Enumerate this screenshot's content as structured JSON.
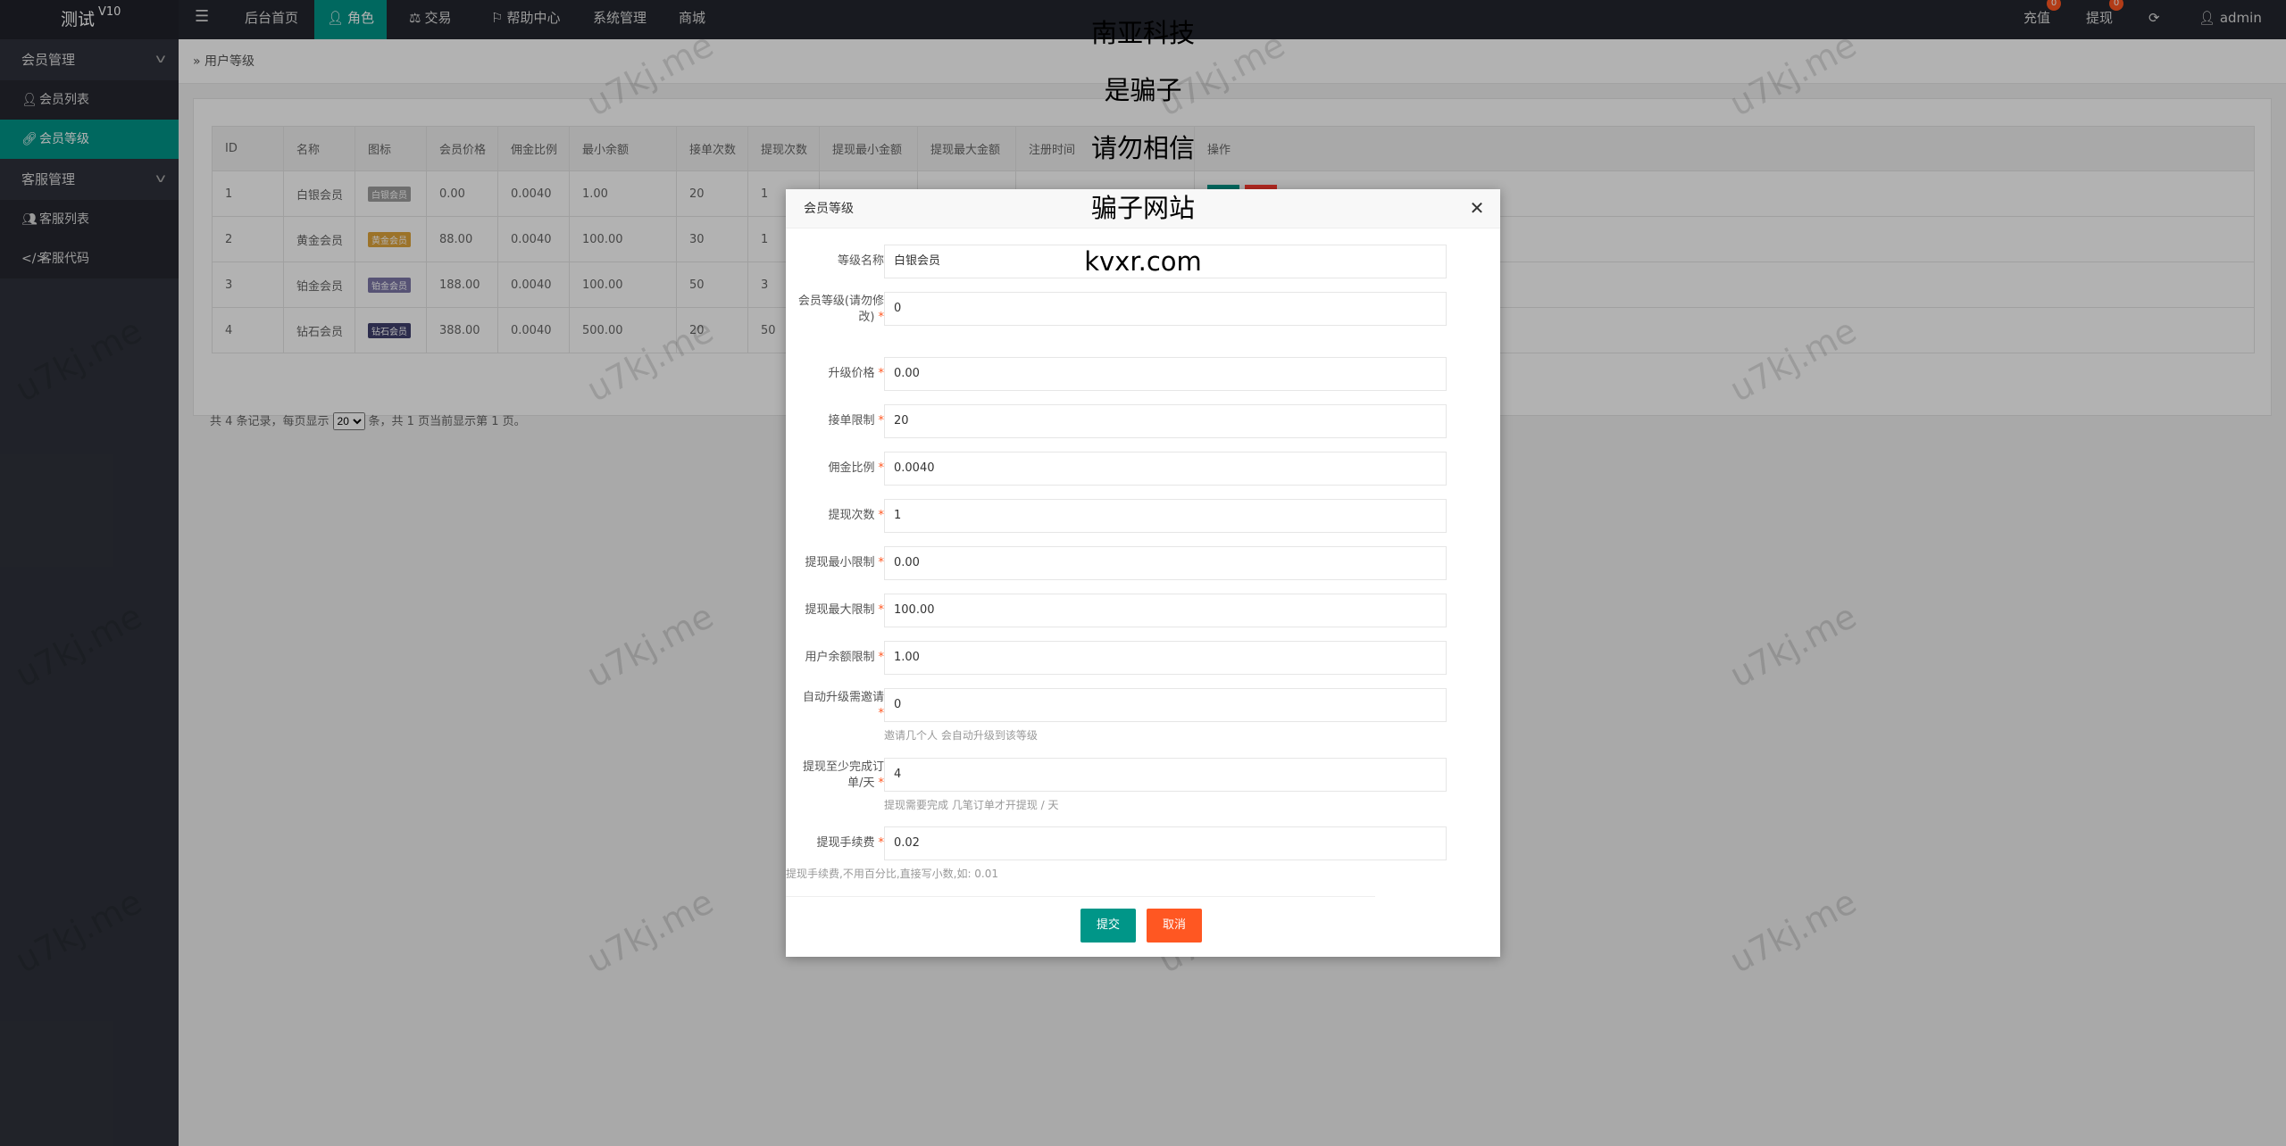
{
  "app": {
    "title": "测试",
    "version": "V10"
  },
  "nav": {
    "items": [
      {
        "label": "后台首页",
        "icon": "",
        "active": false
      },
      {
        "label": "角色",
        "icon": "user-icon",
        "active": true
      },
      {
        "label": "交易",
        "icon": "scale-icon",
        "active": false
      },
      {
        "label": "帮助中心",
        "icon": "flag-icon",
        "active": false
      },
      {
        "label": "系统管理",
        "icon": "",
        "active": false
      },
      {
        "label": "商城",
        "icon": "",
        "active": false
      }
    ],
    "right": {
      "recharge_label": "充值",
      "recharge_badge": "0",
      "withdraw_label": "提现",
      "withdraw_badge": "0",
      "refresh_icon": "refresh-icon",
      "user_label": "admin"
    }
  },
  "sidebar": {
    "groups": [
      {
        "label": "会员管理",
        "items": [
          {
            "label": "会员列表",
            "icon": "user-icon",
            "active": false
          },
          {
            "label": "会员等级",
            "icon": "link-icon",
            "active": true
          }
        ]
      },
      {
        "label": "客服管理",
        "items": [
          {
            "label": "客服列表",
            "icon": "users-icon",
            "active": false
          },
          {
            "label": "客服代码",
            "icon": "code-icon",
            "active": false
          }
        ]
      }
    ]
  },
  "breadcrumb": {
    "label": "用户等级"
  },
  "table": {
    "headers": [
      "ID",
      "名称",
      "图标",
      "会员价格",
      "佣金比例",
      "最小余额",
      "接单次数",
      "提现次数",
      "提现最小金额",
      "提现最大金额",
      "注册时间",
      "操作"
    ],
    "rows": [
      {
        "id": "1",
        "name": "白银会员",
        "icon_label": "白银会员",
        "price": "0.00",
        "commission": "0.0040",
        "min_balance": "1.00",
        "orders": "20",
        "withdraws": "1"
      },
      {
        "id": "2",
        "name": "黄金会员",
        "icon_label": "黄金会员",
        "price": "88.00",
        "commission": "0.0040",
        "min_balance": "100.00",
        "orders": "30",
        "withdraws": "1"
      },
      {
        "id": "3",
        "name": "铂金会员",
        "icon_label": "铂金会员",
        "price": "188.00",
        "commission": "0.0040",
        "min_balance": "100.00",
        "orders": "50",
        "withdraws": "3"
      },
      {
        "id": "4",
        "name": "钻石会员",
        "icon_label": "钻石会员",
        "price": "388.00",
        "commission": "0.0040",
        "min_balance": "500.00",
        "orders": "20",
        "withdraws": "50"
      }
    ],
    "pager": {
      "prefix": "共 4 条记录，每页显示",
      "page_size": "20",
      "suffix": "条，共 1 页当前显示第 1 页。"
    }
  },
  "modal": {
    "title": "会员等级",
    "fields": [
      {
        "label": "等级名称",
        "value": "白银会员",
        "required": false
      },
      {
        "label": "会员等级(请勿修改)",
        "value": "0",
        "required": true
      },
      {
        "label": "升级价格",
        "value": "0.00",
        "required": true
      },
      {
        "label": "接单限制",
        "value": "20",
        "required": true
      },
      {
        "label": "佣金比例",
        "value": "0.0040",
        "required": true
      },
      {
        "label": "提现次数",
        "value": "1",
        "required": true
      },
      {
        "label": "提现最小限制",
        "value": "0.00",
        "required": true
      },
      {
        "label": "提现最大限制",
        "value": "100.00",
        "required": true
      },
      {
        "label": "用户余额限制",
        "value": "1.00",
        "required": true
      },
      {
        "label": "自动升级需邀请",
        "value": "0",
        "required": true,
        "hint": "邀请几个人 会自动升级到该等级"
      },
      {
        "label": "提现至少完成订单/天",
        "value": "4",
        "required": true,
        "hint": "提现需要完成 几笔订单才开提现 / 天"
      },
      {
        "label": "提现手续费",
        "value": "0.02",
        "required": true,
        "hint": "提现手续费,不用百分比,直接写小数,如: 0.01"
      }
    ],
    "submit_label": "提交",
    "cancel_label": "取消"
  },
  "overlay_text": [
    "南亚科技",
    "是骗子",
    "请勿相信",
    "骗子网站",
    "kvxr.com"
  ],
  "watermark": "u7kj.me",
  "colors": {
    "accent": "#009688",
    "danger": "#ff5722",
    "topbar": "#23262e",
    "sidebar": "#2f323b"
  }
}
